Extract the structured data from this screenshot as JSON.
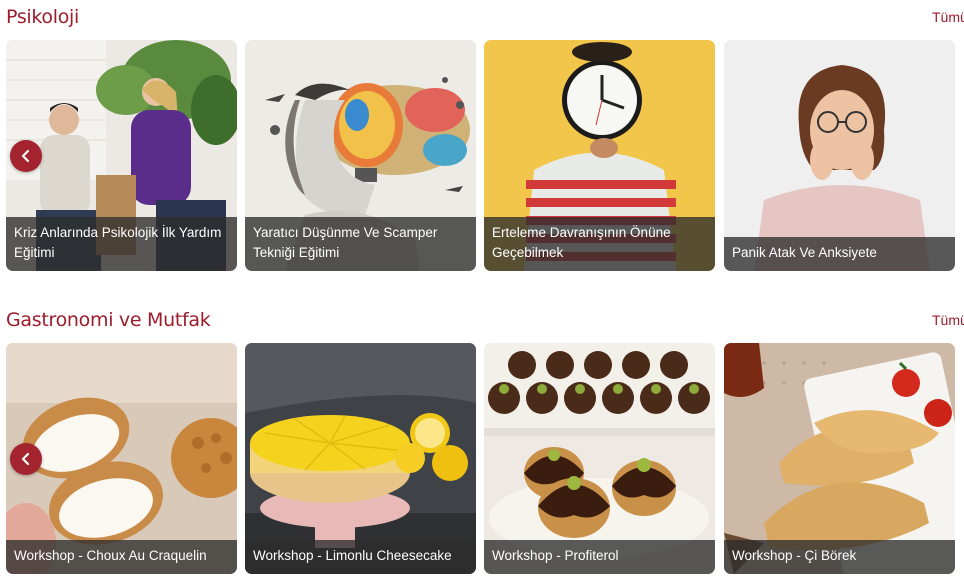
{
  "sections": [
    {
      "title": "Psikoloji",
      "see_all": "Tümü",
      "cards": [
        {
          "caption": "Kriz Anlarında Psikolojik İlk Yardım Eğitimi"
        },
        {
          "caption": "Yaratıcı Düşünme Ve Scamper Tekniği Eğitimi"
        },
        {
          "caption": "Erteleme Davranışının Önüne Geçebilmek"
        },
        {
          "caption": "Panik Atak Ve Anksiyete"
        }
      ]
    },
    {
      "title": "Gastronomi ve Mutfak",
      "see_all": "Tümü",
      "cards": [
        {
          "caption": "Workshop - Choux Au Craquelin"
        },
        {
          "caption": "Workshop - Limonlu Cheesecake"
        },
        {
          "caption": "Workshop - Profiterol"
        },
        {
          "caption": "Workshop - Çi Börek"
        }
      ]
    }
  ],
  "icons": {
    "prev": "chevron-left-icon"
  },
  "colors": {
    "accent": "#9c1c2b",
    "nav_button": "#a3232f",
    "caption_bg": "#2d2d2d"
  }
}
